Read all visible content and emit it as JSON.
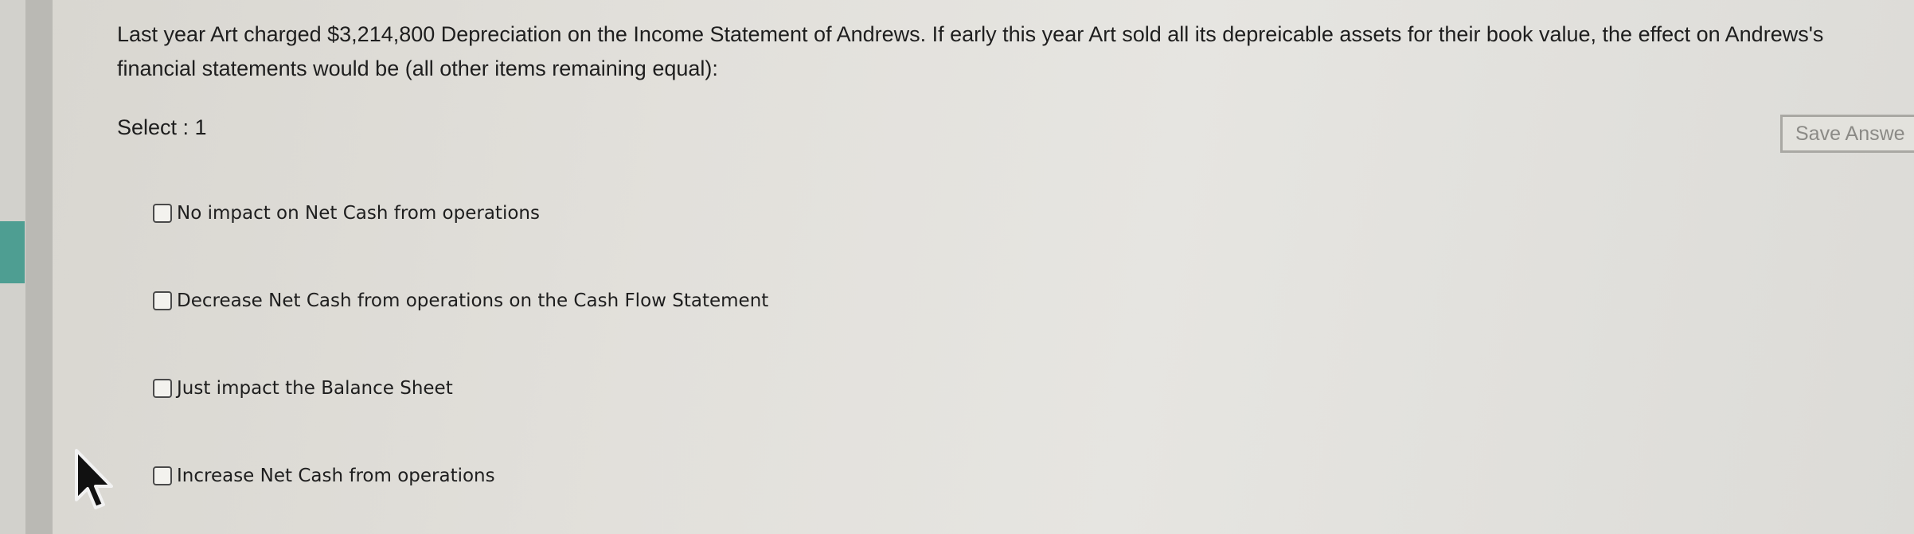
{
  "question": {
    "text": "Last year Art charged $3,214,800 Depreciation on the Income Statement of Andrews. If early this year Art sold all its depreicable assets for their book value, the effect on Andrews's financial statements would be (all other items remaining equal):"
  },
  "select_label": "Select : 1",
  "save_button": {
    "label": "Save Answe"
  },
  "options": [
    {
      "label": "No impact on Net Cash from operations",
      "checked": false
    },
    {
      "label": "Decrease Net Cash from operations on the Cash Flow Statement",
      "checked": false
    },
    {
      "label": "Just impact the Balance Sheet",
      "checked": false
    },
    {
      "label": "Increase Net Cash from operations",
      "checked": false
    }
  ],
  "icons": {
    "checkbox": "checkbox-icon",
    "cursor": "mouse-pointer-icon"
  },
  "colors": {
    "accent": "#4e9e92",
    "text": "#1e1e1e",
    "button_text": "#8b8a86",
    "button_border": "#a9a8a3"
  }
}
